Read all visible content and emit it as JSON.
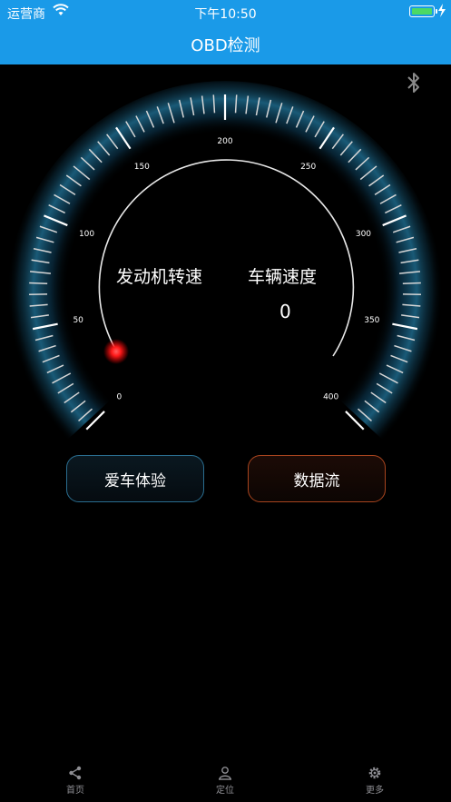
{
  "status_bar": {
    "carrier": "运营商",
    "time": "下午10:50"
  },
  "nav": {
    "title": "OBD检测"
  },
  "gauge": {
    "scale_labels": [
      "0",
      "50",
      "100",
      "150",
      "200",
      "250",
      "300",
      "350",
      "400"
    ],
    "rpm_label": "发动机转速",
    "speed_label": "车辆速度",
    "speed_value": "0",
    "needle_value": 0
  },
  "buttons": {
    "car_experience": "爱车体验",
    "data_stream": "数据流"
  },
  "tabbar": {
    "items": [
      {
        "label": "首页",
        "icon": "share-icon"
      },
      {
        "label": "定位",
        "icon": "location-person-icon"
      },
      {
        "label": "更多",
        "icon": "gear-icon"
      }
    ]
  },
  "colors": {
    "accent": "#1a9ae8",
    "glow": "#1e6a8c",
    "needle_dot": "#ff1a1a"
  }
}
